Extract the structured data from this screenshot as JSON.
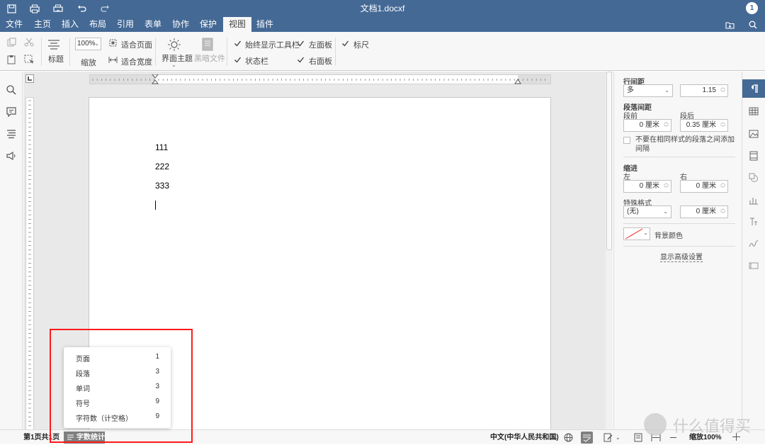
{
  "titlebar": {
    "doc_title": "文档1.docxf",
    "user_initial": "1",
    "quick_access": [
      "save-icon",
      "print-icon",
      "quick-print-icon",
      "undo-icon",
      "redo-icon"
    ]
  },
  "menubar": {
    "tabs": [
      "文件",
      "主页",
      "插入",
      "布局",
      "引用",
      "表单",
      "协作",
      "保护",
      "视图",
      "插件"
    ],
    "active_tab": "视图"
  },
  "toolbar": {
    "heading_label": "标题",
    "zoom_value": "100%",
    "zoom_label": "缩放",
    "fit_page": "适合页面",
    "fit_width": "适合宽度",
    "interface_theme": "界面主题",
    "dark_document": "黑暗文件",
    "always_show_toolbar": "始终显示工具栏",
    "status_bar": "状态栏",
    "left_panel": "左面板",
    "right_panel": "右面板",
    "ruler": "标尺"
  },
  "document": {
    "paragraphs": [
      "111",
      "222",
      "333"
    ]
  },
  "right_panel": {
    "line_spacing_title": "行间距",
    "line_spacing_type": "多",
    "line_spacing_value": "1.15",
    "para_spacing_title": "段落间距",
    "before_label": "段前",
    "after_label": "段后",
    "before_value": "0 厘米",
    "after_value": "0.35 厘米",
    "no_space_same_style": "不要在相同样式的段落之间添加间隔",
    "indent_title": "缩进",
    "left_label": "左",
    "right_label": "右",
    "indent_left_value": "0 厘米",
    "indent_right_value": "0 厘米",
    "special_format_title": "特殊格式",
    "special_format_value": "(无)",
    "special_value": "0 厘米",
    "background_color_label": "背景颜色",
    "advanced_settings": "显示高级设置"
  },
  "statusbar": {
    "page_info": "第1页共1页",
    "word_count_button": "字数统计",
    "language": "中文(中华人民共和国)",
    "zoom_label": "缩放100%"
  },
  "word_count_popup": {
    "rows": [
      {
        "label": "页面",
        "value": "1"
      },
      {
        "label": "段落",
        "value": "3"
      },
      {
        "label": "单词",
        "value": "3"
      },
      {
        "label": "符号",
        "value": "9"
      },
      {
        "label": "字符数（计空格）",
        "value": "9"
      }
    ]
  },
  "watermark": "什么值得买",
  "colors": {
    "accent": "#446995",
    "highlight_box": "#ff1a1a"
  }
}
